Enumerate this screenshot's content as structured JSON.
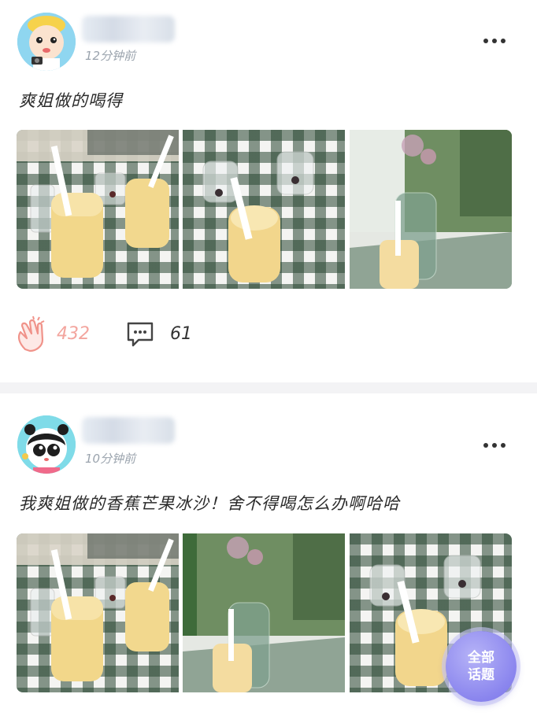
{
  "posts": [
    {
      "username": "",
      "timestamp": "12分钟前",
      "text": "爽姐做的喝得",
      "claps": "432",
      "comments": "61",
      "photos": [
        "drinks-on-gingham-table",
        "drink-with-straw-and-glass",
        "drink-with-flower-vase"
      ]
    },
    {
      "username": "",
      "timestamp": "10分钟前",
      "text": "我爽姐做的香蕉芒果冰沙！舍不得喝怎么办啊哈哈",
      "photos": [
        "drinks-on-gingham-table",
        "drink-with-flower-vase",
        "drink-with-straw-and-glass"
      ]
    }
  ],
  "fab": {
    "line1": "全部",
    "line2": "话题"
  },
  "icons": {
    "clap": "clap-icon",
    "comment": "comment-icon",
    "more": "more-icon"
  },
  "colors": {
    "clap": "#f3a59e",
    "fab": "#8a85ee",
    "divider": "#f3f3f5"
  }
}
